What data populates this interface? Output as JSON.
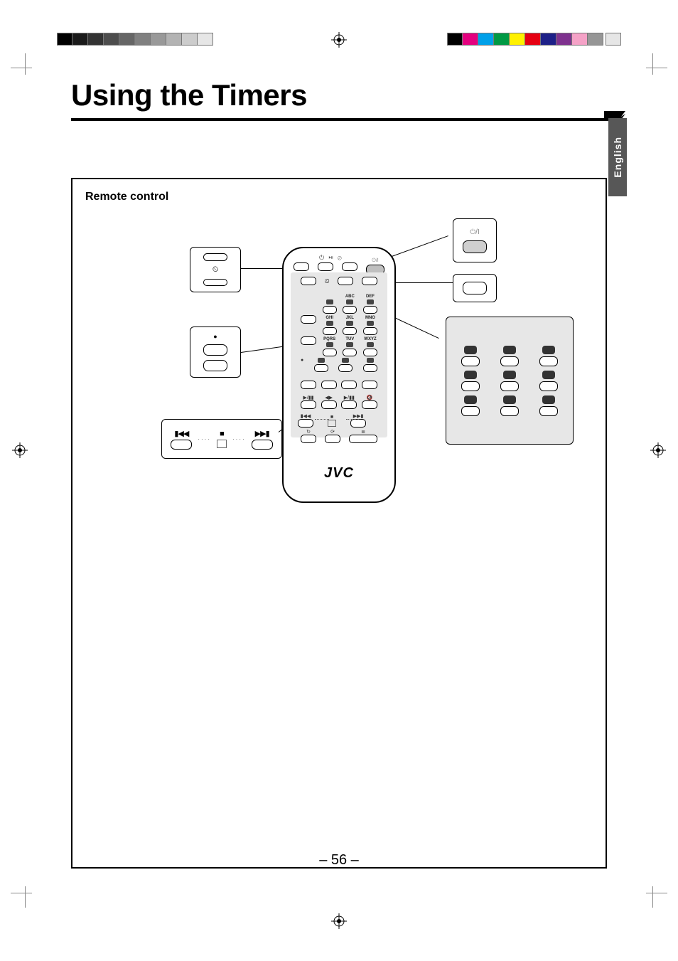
{
  "header": {
    "title": "Using the Timers"
  },
  "lang_tab": "English",
  "panel": {
    "title": "Remote control"
  },
  "remote": {
    "brand": "JVC",
    "top_symbols": "⏻ ⏯ ⊘",
    "power_label": "⏻/I",
    "keypad_labels": [
      "",
      "ABC",
      "DEF",
      "GHI",
      "JKL",
      "MNO",
      "PQRS",
      "TUV",
      "WXYZ"
    ],
    "transport_symbols": {
      "prev": "▮◀◀",
      "stop": "■",
      "next": "▶▶▮",
      "playpause": "▶/▮▮",
      "rewind": "◀▶",
      "mute": "🔇"
    },
    "bottom_icons": [
      "↻",
      "⟳",
      "≣"
    ]
  },
  "callouts": {
    "power": {
      "label": "⏻/I"
    },
    "clock": {
      "icon": "⏲"
    },
    "rec": {
      "label": "●"
    },
    "blank": {},
    "keypad": {},
    "transport": {
      "prev": "▮◀◀",
      "stop": "■",
      "next": "▶▶▮"
    }
  },
  "page_number": "– 56 –",
  "colorbar_gray": [
    "#000000",
    "#1a1a1a",
    "#333333",
    "#4d4d4d",
    "#666666",
    "#808080",
    "#999999",
    "#b3b3b3",
    "#cccccc",
    "#e6e6e6"
  ],
  "colorbar_color": [
    "#000000",
    "#e4007f",
    "#00a0e9",
    "#009944",
    "#fff100",
    "#e60012",
    "#1d2088",
    "#7e318e",
    "#f5a2c7",
    "#969696"
  ]
}
